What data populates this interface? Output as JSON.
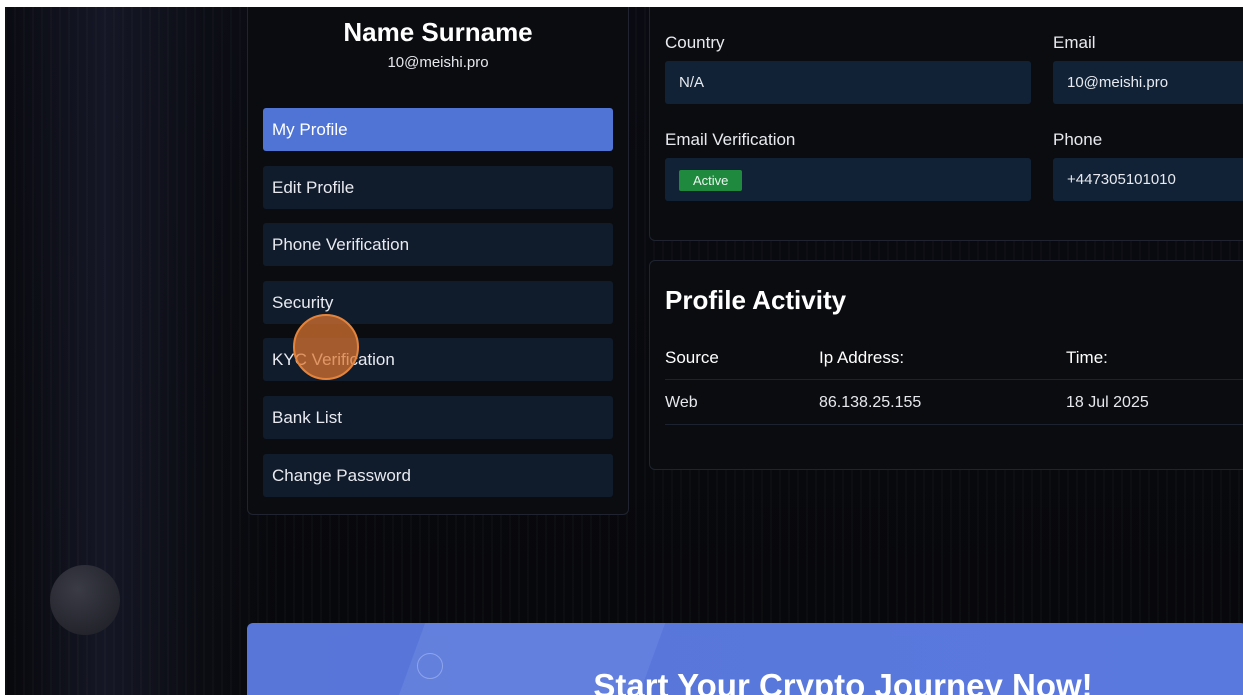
{
  "profile": {
    "name": "Name Surname",
    "email": "10@meishi.pro"
  },
  "menu": {
    "items": [
      {
        "label": "My Profile",
        "active": true
      },
      {
        "label": "Edit Profile",
        "active": false
      },
      {
        "label": "Phone Verification",
        "active": false
      },
      {
        "label": "Security",
        "active": false
      },
      {
        "label": "KYC Verification",
        "active": false
      },
      {
        "label": "Bank List",
        "active": false
      },
      {
        "label": "Change Password",
        "active": false
      }
    ]
  },
  "info": {
    "country_label": "Country",
    "country_value": "N/A",
    "email_label": "Email",
    "email_value": "10@meishi.pro",
    "email_verification_label": "Email Verification",
    "email_verification_status": "Active",
    "phone_label": "Phone",
    "phone_value": "+447305101010"
  },
  "activity": {
    "title": "Profile Activity",
    "columns": [
      "Source",
      "Ip Address:",
      "Time:"
    ],
    "rows": [
      [
        "Web",
        "86.138.25.155",
        "18 Jul 2025"
      ]
    ]
  },
  "banner": {
    "text": "Start Your Crypto Journey Now!"
  },
  "colors": {
    "accent": "#4f74d6",
    "status_active": "#1f8a3e",
    "field_bg": "#112236",
    "menu_bg": "#101c2c"
  }
}
